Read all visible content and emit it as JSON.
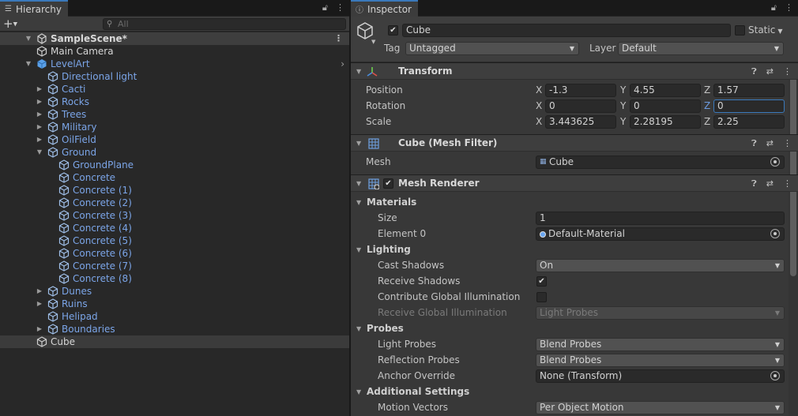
{
  "hierarchy": {
    "tab_label": "Hierarchy",
    "add_label": "+",
    "search_placeholder": "All",
    "scene_name": "SampleScene*",
    "items": [
      {
        "label": "Main Camera",
        "depth": 1,
        "arrow": "",
        "color": "white"
      },
      {
        "label": "LevelArt",
        "depth": 1,
        "arrow": "down",
        "color": "blue",
        "prefab": true
      },
      {
        "label": "Directional light",
        "depth": 2,
        "arrow": "",
        "color": "blue"
      },
      {
        "label": "Cacti",
        "depth": 2,
        "arrow": "right",
        "color": "blue"
      },
      {
        "label": "Rocks",
        "depth": 2,
        "arrow": "right",
        "color": "blue"
      },
      {
        "label": "Trees",
        "depth": 2,
        "arrow": "right",
        "color": "blue"
      },
      {
        "label": "Military",
        "depth": 2,
        "arrow": "right",
        "color": "blue"
      },
      {
        "label": "OilField",
        "depth": 2,
        "arrow": "right",
        "color": "blue"
      },
      {
        "label": "Ground",
        "depth": 2,
        "arrow": "down",
        "color": "blue"
      },
      {
        "label": "GroundPlane",
        "depth": 3,
        "arrow": "",
        "color": "blue"
      },
      {
        "label": "Concrete",
        "depth": 3,
        "arrow": "",
        "color": "blue"
      },
      {
        "label": "Concrete (1)",
        "depth": 3,
        "arrow": "",
        "color": "blue"
      },
      {
        "label": "Concrete (2)",
        "depth": 3,
        "arrow": "",
        "color": "blue"
      },
      {
        "label": "Concrete (3)",
        "depth": 3,
        "arrow": "",
        "color": "blue"
      },
      {
        "label": "Concrete (4)",
        "depth": 3,
        "arrow": "",
        "color": "blue"
      },
      {
        "label": "Concrete (5)",
        "depth": 3,
        "arrow": "",
        "color": "blue"
      },
      {
        "label": "Concrete (6)",
        "depth": 3,
        "arrow": "",
        "color": "blue"
      },
      {
        "label": "Concrete (7)",
        "depth": 3,
        "arrow": "",
        "color": "blue"
      },
      {
        "label": "Concrete (8)",
        "depth": 3,
        "arrow": "",
        "color": "blue"
      },
      {
        "label": "Dunes",
        "depth": 2,
        "arrow": "right",
        "color": "blue"
      },
      {
        "label": "Ruins",
        "depth": 2,
        "arrow": "right",
        "color": "blue"
      },
      {
        "label": "Helipad",
        "depth": 2,
        "arrow": "",
        "color": "blue"
      },
      {
        "label": "Boundaries",
        "depth": 2,
        "arrow": "right",
        "color": "blue"
      },
      {
        "label": "Cube",
        "depth": 1,
        "arrow": "",
        "color": "white",
        "selected": true
      }
    ]
  },
  "inspector": {
    "tab_label": "Inspector",
    "object_name": "Cube",
    "static_label": "Static",
    "tag_label": "Tag",
    "tag_value": "Untagged",
    "layer_label": "Layer",
    "layer_value": "Default",
    "transform": {
      "title": "Transform",
      "position_label": "Position",
      "rotation_label": "Rotation",
      "scale_label": "Scale",
      "axis_x": "X",
      "axis_y": "Y",
      "axis_z": "Z",
      "position": [
        "-1.3",
        "4.55",
        "1.57"
      ],
      "rotation": [
        "0",
        "0",
        "0"
      ],
      "scale": [
        "3.443625",
        "2.28195",
        "2.25"
      ]
    },
    "mesh_filter": {
      "title": "Cube (Mesh Filter)",
      "mesh_label": "Mesh",
      "mesh_value": "Cube"
    },
    "mesh_renderer": {
      "title": "Mesh Renderer",
      "materials_label": "Materials",
      "size_label": "Size",
      "size_value": "1",
      "element0_label": "Element 0",
      "element0_value": "Default-Material",
      "lighting_label": "Lighting",
      "cast_shadows_label": "Cast Shadows",
      "cast_shadows_value": "On",
      "receive_shadows_label": "Receive Shadows",
      "contribute_gi_label": "Contribute Global Illumination",
      "receive_gi_label": "Receive Global Illumination",
      "receive_gi_value": "Light Probes",
      "probes_label": "Probes",
      "light_probes_label": "Light Probes",
      "light_probes_value": "Blend Probes",
      "reflection_probes_label": "Reflection Probes",
      "reflection_probes_value": "Blend Probes",
      "anchor_override_label": "Anchor Override",
      "anchor_override_value": "None (Transform)",
      "additional_label": "Additional Settings",
      "motion_vectors_label": "Motion Vectors",
      "motion_vectors_value": "Per Object Motion"
    }
  },
  "colors": {
    "accent": "#3a79bb",
    "prefab_blue": "#7ba5e8"
  }
}
